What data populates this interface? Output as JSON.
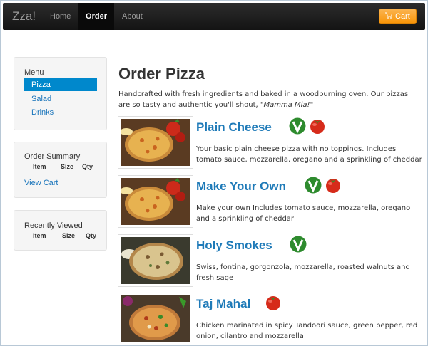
{
  "navbar": {
    "brand": "Zza!",
    "items": [
      {
        "label": "Home"
      },
      {
        "label": "Order"
      },
      {
        "label": "About"
      }
    ],
    "cart_label": "Cart"
  },
  "sidebar": {
    "menu": {
      "title": "Menu",
      "items": [
        {
          "label": "Pizza"
        },
        {
          "label": "Salad"
        },
        {
          "label": "Drinks"
        }
      ]
    },
    "order_summary": {
      "title": "Order Summary",
      "columns": [
        "Item",
        "Size",
        "Qty"
      ],
      "view_cart": "View Cart"
    },
    "recently_viewed": {
      "title": "Recently Viewed",
      "columns": [
        "Item",
        "Size",
        "Qty"
      ]
    }
  },
  "main": {
    "title": "Order Pizza",
    "intro_text": "Handcrafted with fresh ingredients and baked in a woodburning oven. Our pizzas are so tasty and authentic you'll shout, \"",
    "intro_emphasis": "Mamma Mia!",
    "intro_end": "\"",
    "pizzas": [
      {
        "name": "Plain Cheese",
        "description": "Your basic plain cheese pizza with no toppings. Includes tomato sauce, mozzarella, oregano and a sprinkling of cheddar",
        "badges": [
          "vegetarian-icon",
          "tomato-icon"
        ]
      },
      {
        "name": "Make Your Own",
        "description": "Make your own Includes tomato sauce, mozzarella, oregano and a sprinkling of cheddar",
        "badges": [
          "vegetarian-icon",
          "tomato-icon"
        ]
      },
      {
        "name": "Holy Smokes",
        "description": "Swiss, fontina, gorgonzola, mozzarella, roasted walnuts and fresh sage",
        "badges": [
          "vegetarian-icon"
        ]
      },
      {
        "name": "Taj Mahal",
        "description": "Chicken marinated in spicy Tandoori sauce, green pepper, red onion, cilantro and mozzarella",
        "badges": [
          "tomato-icon"
        ]
      }
    ]
  },
  "colors": {
    "link": "#1e7ab8",
    "active_menu": "#0088cc",
    "cart_button": "#f89406",
    "veg_badge": "#2e8b2e",
    "tomato": "#d62b1a"
  }
}
